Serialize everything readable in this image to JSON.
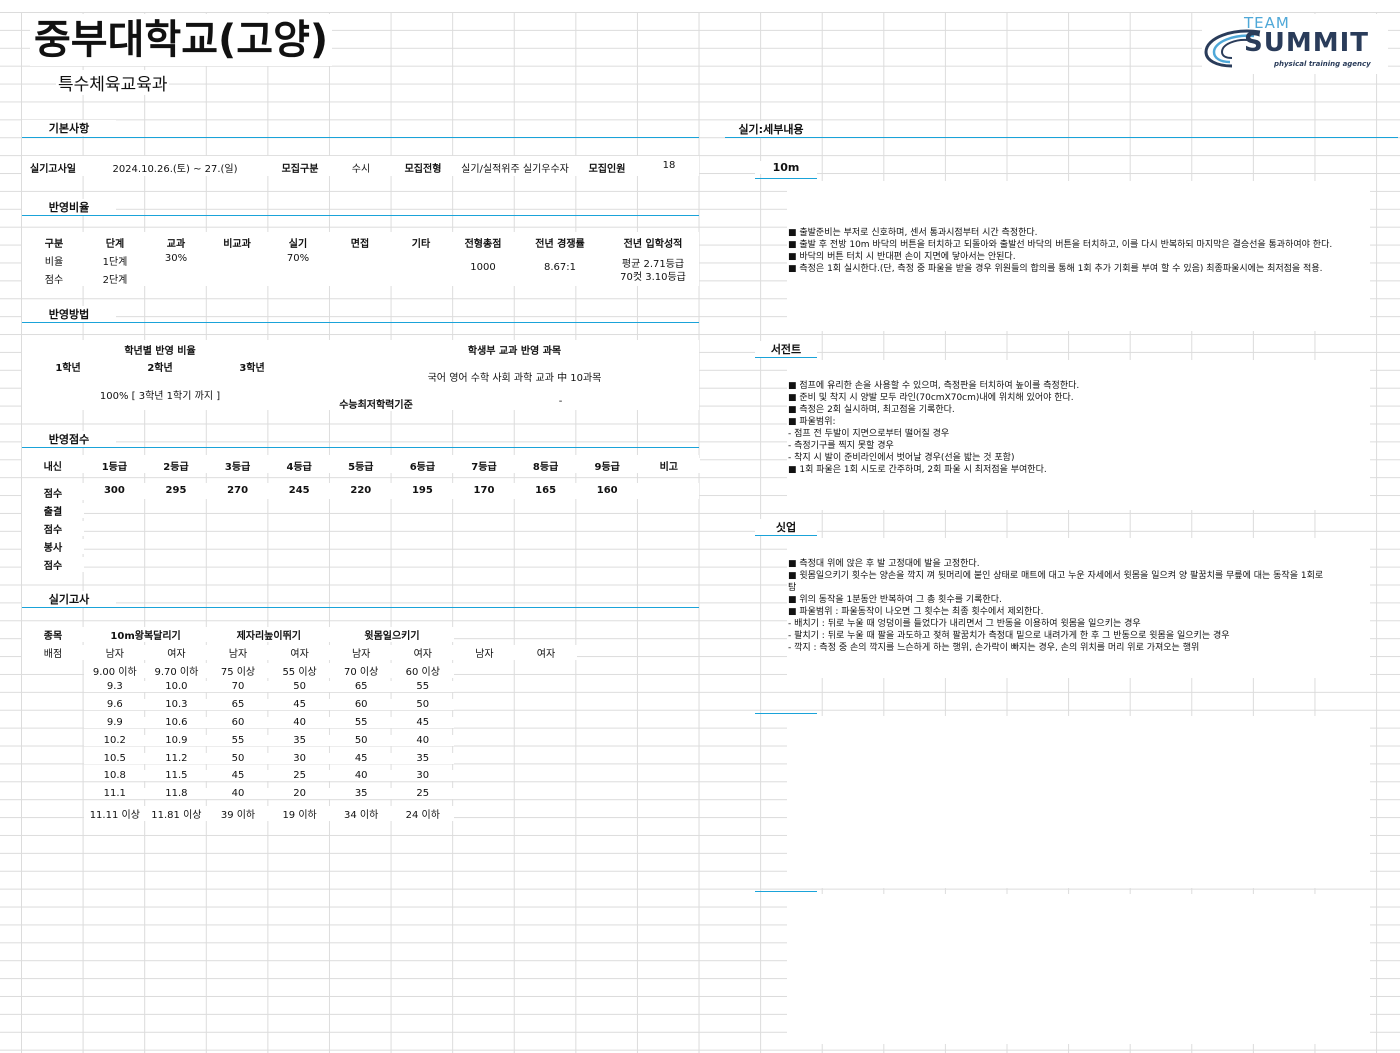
{
  "header": {
    "title": "중부대학교(고양)",
    "subtitle": "특수체육교육과",
    "logo_team": "TEAM",
    "logo_summit": "SUMMIT",
    "logo_sub": "physical training agency"
  },
  "basic": {
    "title": "기본사항",
    "exam_date_label": "실기고사일",
    "exam_date": "2024.10.26.(토) ~ 27.(일)",
    "type_label": "모집구분",
    "type": "수시",
    "track_label": "모집전형",
    "track": "실기/실적위주 실기우수자",
    "quota_label": "모집인원",
    "quota": "18"
  },
  "ratio": {
    "title": "반영비율",
    "headers": [
      "구분",
      "단계",
      "교과",
      "비교과",
      "실기",
      "면접",
      "기타",
      "전형총점",
      "전년 경쟁률",
      "전년 입학성적"
    ],
    "row1_label": "비율",
    "row1_stage": "1단계",
    "row1_gyogwa": "30%",
    "row1_silgi": "70%",
    "row2_label": "점수",
    "row2_stage": "2단계",
    "total": "1000",
    "competition": "8.67:1",
    "prev_avg": "평균 2.71등급",
    "prev_cut": "70컷 3.10등급"
  },
  "method": {
    "title": "반영방법",
    "grade_ratio_title": "학년별 반영 비율",
    "grade1": "1학년",
    "grade2": "2학년",
    "grade3": "3학년",
    "grade_ratio_value": "100% [ 3학년 1학기 까지 ]",
    "subjects_title": "학생부 교과 반영 과목",
    "subjects_value": "국어 영어 수학 사회 과학 교과 中 10과목",
    "csat_label": "수능최저학력기준",
    "csat_value": "-"
  },
  "scores": {
    "title": "반영점수",
    "headers": [
      "내신",
      "1등급",
      "2등급",
      "3등급",
      "4등급",
      "5등급",
      "6등급",
      "7등급",
      "8등급",
      "9등급",
      "비고"
    ],
    "points_label": "점수",
    "points": [
      "300",
      "295",
      "270",
      "245",
      "220",
      "195",
      "170",
      "165",
      "160"
    ],
    "extra_labels": [
      "출결",
      "점수",
      "봉사",
      "점수"
    ]
  },
  "practical": {
    "title": "실기고사",
    "item_label": "종목",
    "score_label": "배점",
    "events": [
      "10m왕복달리기",
      "제자리높이뛰기",
      "윗몸일으키기"
    ],
    "gender": [
      "남자",
      "여자",
      "남자",
      "여자",
      "남자",
      "여자",
      "남자",
      "여자"
    ],
    "rows": [
      [
        "9.00 이하",
        "9.70 이하",
        "75 이상",
        "55 이상",
        "70 이상",
        "60 이상"
      ],
      [
        "9.3",
        "10.0",
        "70",
        "50",
        "65",
        "55"
      ],
      [
        "9.6",
        "10.3",
        "65",
        "45",
        "60",
        "50"
      ],
      [
        "9.9",
        "10.6",
        "60",
        "40",
        "55",
        "45"
      ],
      [
        "10.2",
        "10.9",
        "55",
        "35",
        "50",
        "40"
      ],
      [
        "10.5",
        "11.2",
        "50",
        "30",
        "45",
        "35"
      ],
      [
        "10.8",
        "11.5",
        "45",
        "25",
        "40",
        "30"
      ],
      [
        "11.1",
        "11.8",
        "40",
        "20",
        "35",
        "25"
      ],
      [
        "11.11 이상",
        "11.81 이상",
        "39 이하",
        "19 이하",
        "34 이하",
        "24 이하"
      ]
    ]
  },
  "details": {
    "title": "실기:세부내용",
    "events": [
      {
        "name": "10m",
        "lines": [
          "■ 출발준비는 부저로 신호하며, 센서 통과시점부터 시간 측정한다.",
          "■ 출발 후 전방 10m 바닥의 버튼을 터치하고 되돌아와 출발선 바닥의 버튼을 터치하고, 이를 다시 반복하되 마지막은 결승선을 통과하여야 한다.",
          "■ 바닥의 버튼 터치 시 반대편 손이 지면에 닿아서는 안된다.",
          "■ 측정은 1회 실시한다.(단, 측정 중 파울을 받을 경우 위원들의 합의를 통해 1회 추가 기회를 부여 할 수 있음) 최종파울시에는 최저점을 적용."
        ]
      },
      {
        "name": "서전트",
        "lines": [
          "■ 점프에 유리한 손을 사용할 수 있으며, 측정판을 터치하여 높이를 측정한다.",
          "■ 준비 및 착지 시 양발 모두 라인(70cmX70cm)내에 위치해 있어야 한다.",
          "■ 측정은 2회 실시하며, 최고점을 기록한다.",
          "■ 파울범위:",
          "- 점프 전 두발이 지면으로부터 떨어질 경우",
          "- 측정기구를 찍지 못할 경우",
          "- 착지 시 발이 준비라인에서 벗어날 경우(선을 밟는 것 포함)",
          "■ 1회 파울은 1회 시도로 간주하며, 2회 파울 시 최저점을 부여한다."
        ]
      },
      {
        "name": "싯업",
        "lines": [
          "■ 측정대 위에 앉은 후 발 고정대에 발을 고정한다.",
          "■ 윗몸일으키기 횟수는 양손을 깍지 껴 뒷머리에 붙인 상태로 매트에 대고 누운 자세에서 윗몸을 일으켜 양 팔꿈치를 무릎에 대는 동작을 1회로",
          "탐",
          "■ 위의 동작을 1분동안 반복하여 그 총 횟수를 기록한다.",
          "■ 파울범위 : 파울동작이 나오면 그 횟수는 최종 횟수에서 제외한다.",
          "- 배치기 : 뒤로 누울 때 엉덩이를 들었다가 내리면서 그 반동을 이용하여 윗몸을 일으키는 경우",
          "- 팔치기 : 뒤로 누울 때 팔을 과도하고 젖혀 팔꿈치가 측정대 밑으로 내려가게 한 후 그 반동으로 윗몸을 일으키는 경우",
          "- 깍지 : 측정 중 손의 깍지를 느슨하게 하는 행위, 손가락이 빠지는 경우, 손의 위치를 머리 위로 가져오는 행위"
        ]
      }
    ]
  }
}
